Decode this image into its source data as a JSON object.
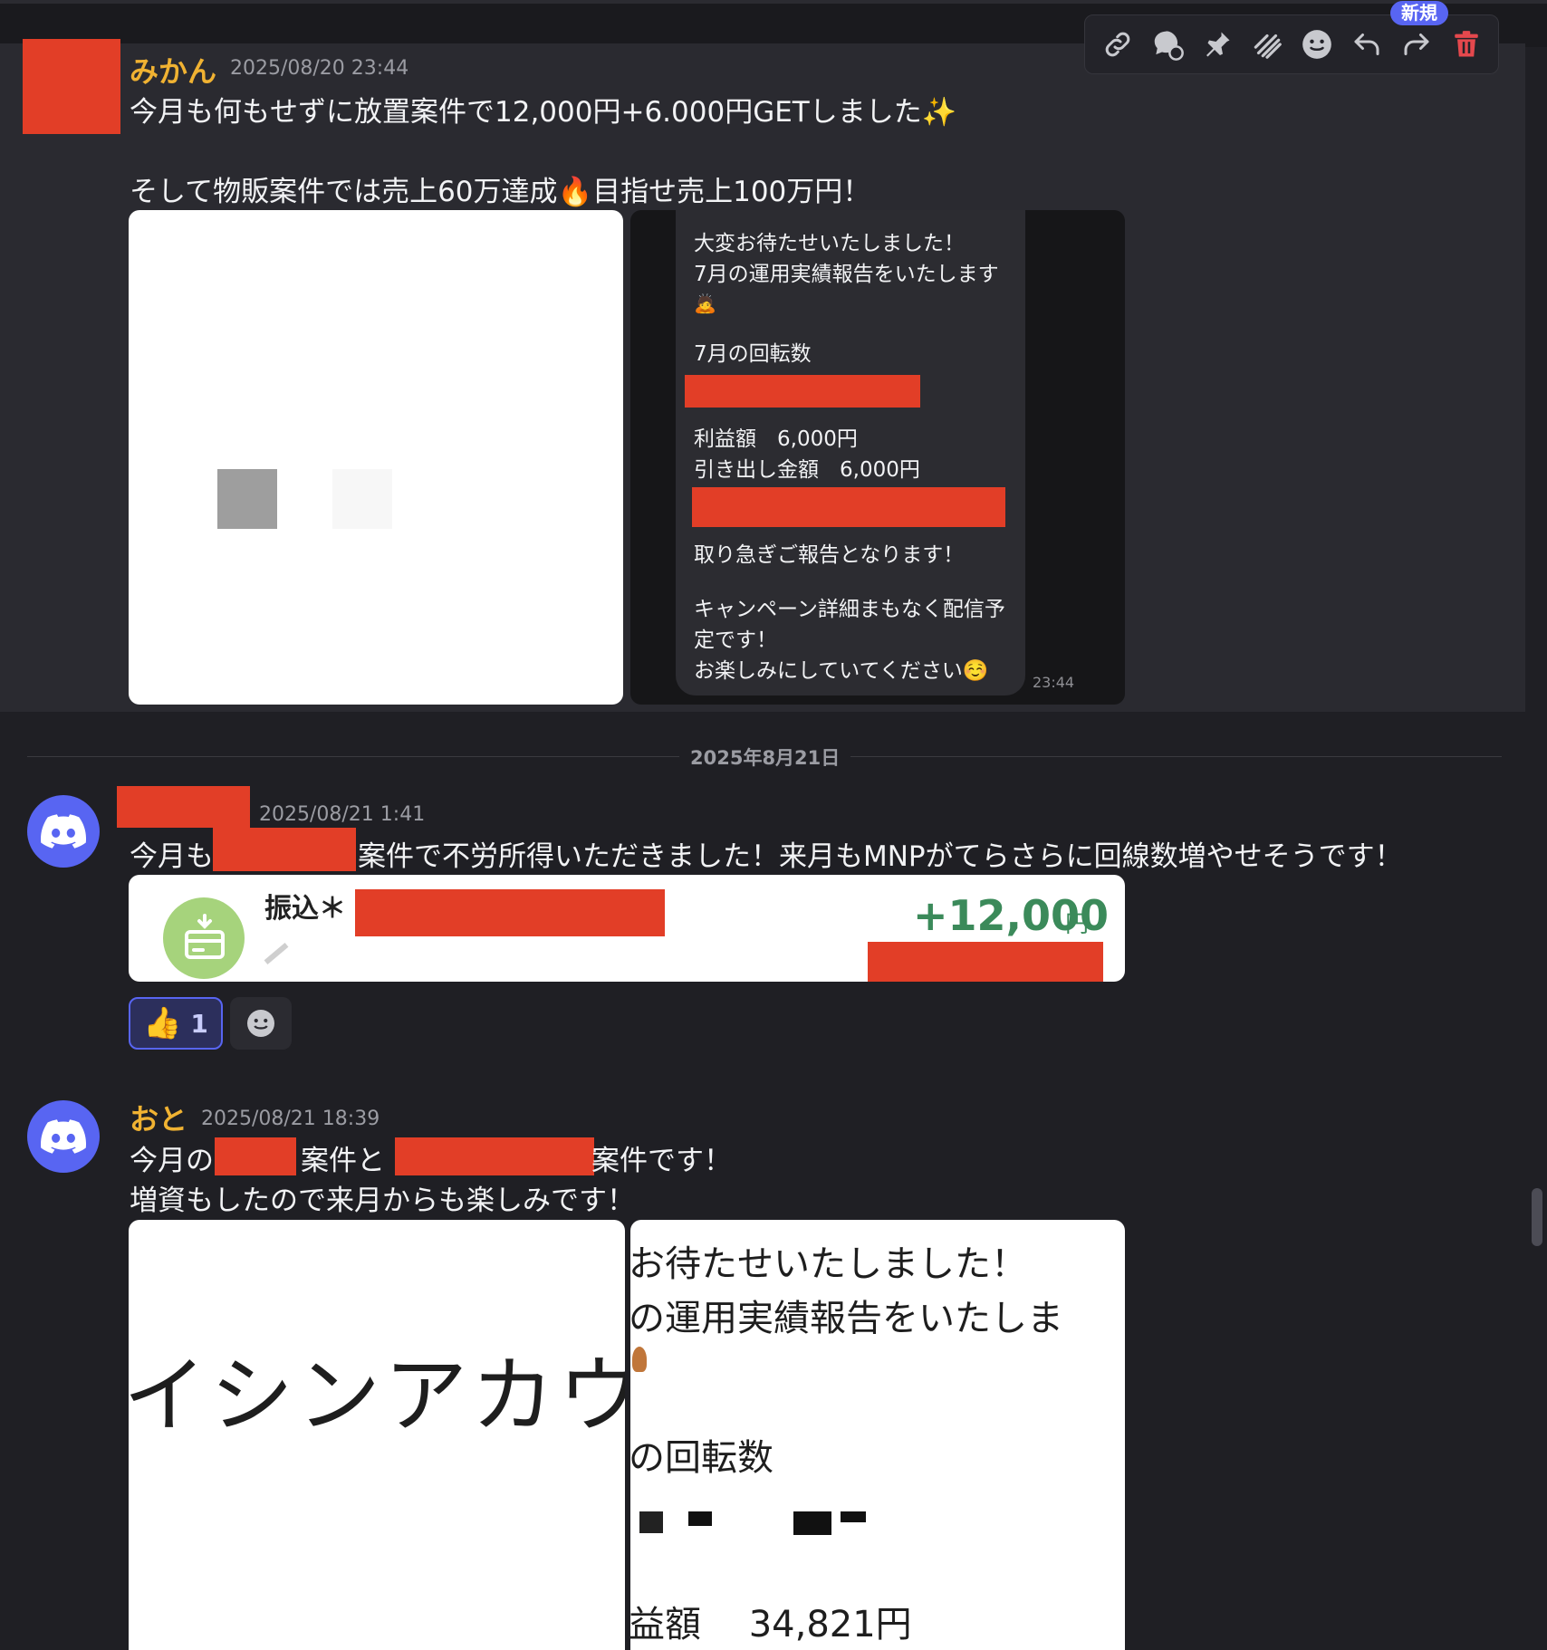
{
  "toolbar": {
    "new_badge": "新規",
    "icons": [
      "link-icon",
      "thread-icon",
      "pin-icon",
      "apps-icon",
      "emoji-icon",
      "reply-icon",
      "forward-icon",
      "delete-icon"
    ]
  },
  "messages": [
    {
      "username": "みかん",
      "timestamp": "2025/08/20 23:44",
      "line1": "今月も何もせずに放置案件で12,000円+6.000円GETしました✨",
      "line2": "そして物販案件では売上60万達成🔥目指せ売上100万円！",
      "chat_image": {
        "lines": [
          "大変お待たせいたしました！",
          "7月の運用実績報告をいたします",
          "🙇",
          "7月の回転数",
          "利益額　6,000円",
          "引き出し金額　6,000円",
          "取り急ぎご報告となります！",
          "キャンペーン詳細まもなく配信予",
          "定です！",
          "お楽しみにしていてください☺️"
        ],
        "time": "23:44"
      }
    },
    {
      "date_divider": "2025年8月21日",
      "timestamp": "2025/08/21 1:41",
      "text_a": "今月も",
      "text_b": "案件で不労所得いただきました！来月もMNPがてらさらに回線数増やせそうです！",
      "transfer_card": {
        "label": "振込＊",
        "amount": "+12,000",
        "currency": "円"
      },
      "reactions": [
        {
          "emoji": "👍",
          "count": "1"
        }
      ]
    },
    {
      "username": "おと",
      "timestamp": "2025/08/21 18:39",
      "line1_a": "今月の",
      "line1_b": "案件と",
      "line1_c": "案件です！",
      "line2": "増資もしたので来月からも楽しみです！",
      "image_left_text": "イシンアカウ",
      "image_right": {
        "line1": "お待たせいたしました！",
        "line2": "の運用実績報告をいたしま",
        "line3": "の回転数",
        "line4": "益額　 34,821円"
      }
    }
  ],
  "colors": {
    "username": "#f0b232",
    "redaction": "#e23e27",
    "discord_blurple": "#5865f2",
    "background": "#1f1f24",
    "amount_green": "#3b8a5a"
  }
}
